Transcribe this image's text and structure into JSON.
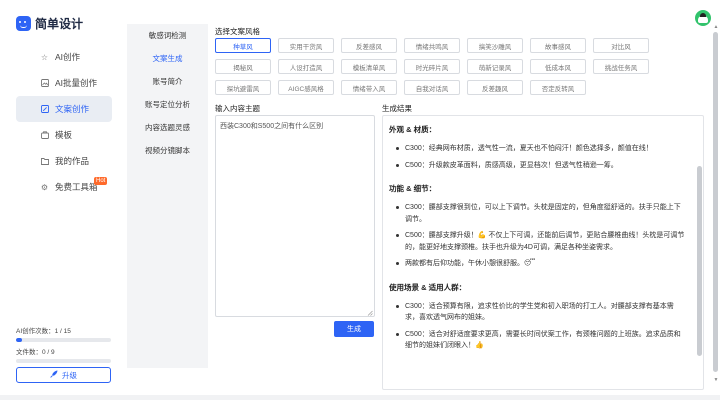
{
  "brand": {
    "name": "简单设计",
    "color": "#2e64f5"
  },
  "nav": [
    {
      "label": "AI创作",
      "icon": "star-icon"
    },
    {
      "label": "AI批量创作",
      "icon": "image-icon"
    },
    {
      "label": "文案创作",
      "icon": "edit-icon"
    },
    {
      "label": "模板",
      "icon": "template-icon"
    },
    {
      "label": "我的作品",
      "icon": "folder-icon"
    },
    {
      "label": "免费工具箱",
      "icon": "gear-icon",
      "badge": "Hot"
    }
  ],
  "quota": {
    "ai": {
      "label": "AI创作次数：1 / 15",
      "fraction": 0.067
    },
    "copy": {
      "label": "文件数：0 / 9",
      "fraction": 0
    }
  },
  "upgrade_label": "升级",
  "subnav": [
    "敏感词检测",
    "文案生成",
    "账号简介",
    "账号定位分析",
    "内容选题灵感",
    "视频分镜脚本"
  ],
  "styles": {
    "title": "选择文案风格",
    "chips": [
      "种草风",
      "实用干货风",
      "反差感风",
      "情绪共鸣风",
      "搞笑沙雕风",
      "故事感风",
      "对比风",
      "揭秘风",
      "人设打造风",
      "模板清单风",
      "时光碎片风",
      "萌新记录风",
      "低成本风",
      "挑战任务风",
      "探坑避雷风",
      "AIGC感风格",
      "情绪带入风",
      "自我对话风",
      "反差趣风",
      "否定反转风"
    ]
  },
  "input": {
    "title": "输入内容主题",
    "value": "西装C300和S500之间有什么区别"
  },
  "generate_label": "生成",
  "result": {
    "title": "生成结果",
    "sections": [
      {
        "heading": "外观 & 材质：",
        "items": [
          "C300：经典网布材质，透气性一流，夏天也不怕闷汗！颜色选择多，颜值在线！",
          "C500：升级款皮革面料，质感高级，更显档次！但透气性稍逊一筹。"
        ]
      },
      {
        "heading": "功能 & 细节：",
        "items": [
          "C300：腰部支撑很到位，可以上下调节。头枕是固定的，但角度挺舒适的。扶手只能上下调节。",
          "C500：腰部支撑升级！💪 不仅上下可调，还能前后调节，更贴合腰椎曲线！头枕是可调节的，能更好地支撑颈椎。扶手也升级为4D可调，满足各种坐姿需求。",
          "两款都有后仰功能，午休小憩很舒服。😴"
        ]
      },
      {
        "heading": "使用场景 & 适用人群：",
        "items": [
          "C300：适合预算有限，追求性价比的学生党和初入职场的打工人。对腰部支撑有基本需求，喜欢透气网布的姐妹。",
          "C500：适合对舒适度要求更高，需要长时间伏案工作，有颈椎问题的上班族。追求品质和细节的姐妹们闭眼入！👍"
        ]
      }
    ]
  }
}
